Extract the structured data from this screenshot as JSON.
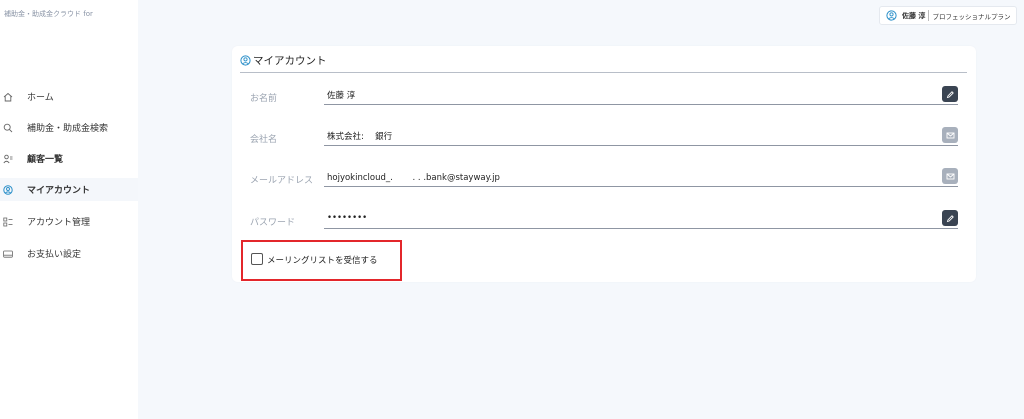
{
  "app": {
    "brand": "補助金・助成金クラウド for"
  },
  "sidebar": {
    "items": [
      {
        "label": "ホーム",
        "icon": "home-icon"
      },
      {
        "label": "補助金・助成金検索",
        "icon": "search-icon"
      },
      {
        "label": "顧客一覧",
        "icon": "customers-icon"
      },
      {
        "label": "マイアカウント",
        "icon": "account-icon",
        "active": true
      },
      {
        "label": "アカウント管理",
        "icon": "account-management-icon"
      },
      {
        "label": "お支払い設定",
        "icon": "payment-icon"
      }
    ]
  },
  "header": {
    "user_name": "佐藤 淳",
    "plan": "プロフェッショナルプラン"
  },
  "account": {
    "title": "マイアカウント",
    "fields": [
      {
        "label": "お名前",
        "value": "佐藤 淳",
        "action": "edit-icon"
      },
      {
        "label": "会社名",
        "value": "株式会社:　 銀行",
        "action": "mail-icon"
      },
      {
        "label": "メールアドレス",
        "value": "hojyokincloud_.　　 . . .bank@stayway.jp",
        "action": "mail-icon"
      },
      {
        "label": "パスワード",
        "value": "••••••••",
        "action": "edit-icon"
      }
    ],
    "mailing_list_label": "メーリングリストを受信する",
    "mailing_list_checked": false
  },
  "colors": {
    "highlight": "#e3262b",
    "accent": "#2a8fc9",
    "dark_button": "#3a4452",
    "light_button": "#a8b0bc"
  }
}
